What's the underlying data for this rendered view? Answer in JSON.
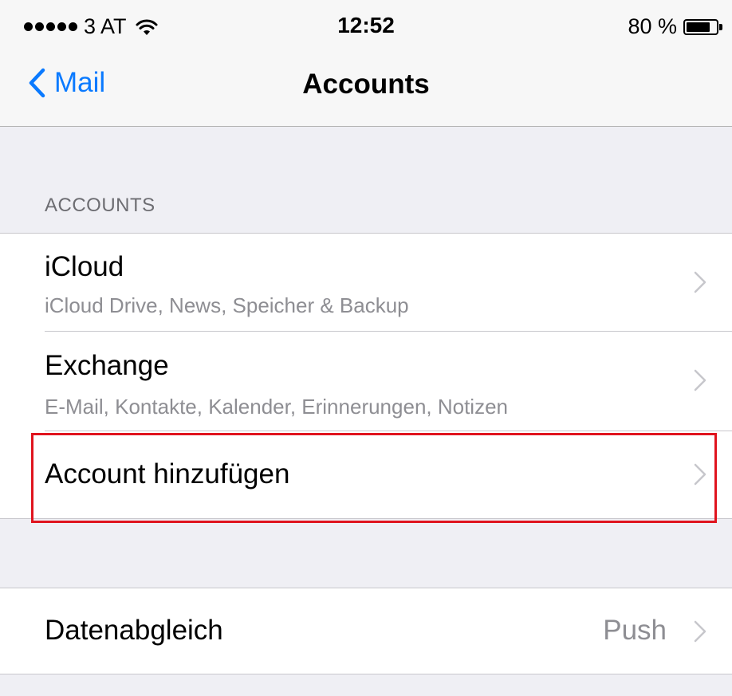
{
  "status_bar": {
    "carrier": "3 AT",
    "time": "12:52",
    "battery_text": "80 %",
    "battery_level": 0.8
  },
  "nav": {
    "back_label": "Mail",
    "title": "Accounts"
  },
  "accounts_section": {
    "header": "ACCOUNTS",
    "items": [
      {
        "title": "iCloud",
        "subtitle": "iCloud Drive, News, Speicher & Backup"
      },
      {
        "title": "Exchange",
        "subtitle": "E-Mail, Kontakte, Kalender, Erinnerungen, Notizen"
      },
      {
        "title": "Account hinzufügen"
      }
    ]
  },
  "fetch_section": {
    "items": [
      {
        "title": "Datenabgleich",
        "value": "Push"
      }
    ]
  },
  "colors": {
    "accent": "#0a7aff",
    "highlight": "#e0141e",
    "background": "#efeff4"
  }
}
